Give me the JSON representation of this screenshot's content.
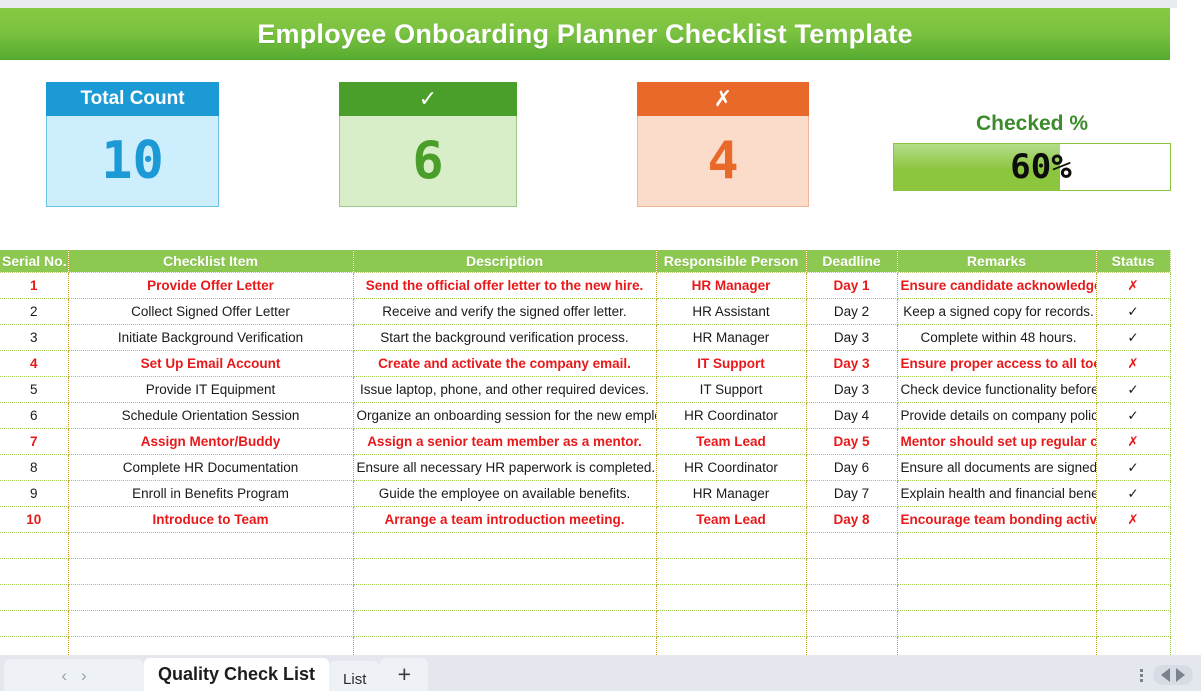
{
  "banner": {
    "title": "Employee Onboarding Planner Checklist Template"
  },
  "colors": {
    "brand_green": "#8cc63f",
    "header_green": "#8dc850",
    "blue": "#1b9ad6",
    "dark_green": "#4a9e2a",
    "orange": "#e8692a",
    "red": "#e8191a",
    "check_green": "#1e8c34"
  },
  "kpis": {
    "total": {
      "label": "Total Count",
      "value": "10"
    },
    "checked": {
      "label": "✓",
      "value": "6"
    },
    "unchecked": {
      "label": "✗",
      "value": "4"
    },
    "percent": {
      "label": "Checked %",
      "value": "60%",
      "fill_percent": 60
    }
  },
  "table": {
    "headers": [
      "Serial No.",
      "Checklist Item",
      "Description",
      "Responsible Person",
      "Deadline",
      "Remarks",
      "Status"
    ],
    "status_glyphs": {
      "done": "✓",
      "pending": "✗"
    },
    "rows": [
      {
        "serial": "1",
        "item": "Provide Offer Letter",
        "description": "Send the official offer letter to the new hire.",
        "responsible": "HR Manager",
        "deadline": "Day 1",
        "remarks": "Ensure candidate acknowledges receipt.",
        "status": "✗",
        "state": "pending"
      },
      {
        "serial": "2",
        "item": "Collect Signed Offer Letter",
        "description": "Receive and verify the signed offer letter.",
        "responsible": "HR Assistant",
        "deadline": "Day 2",
        "remarks": "Keep a signed copy for records.",
        "status": "✓",
        "state": "done"
      },
      {
        "serial": "3",
        "item": "Initiate Background Verification",
        "description": "Start the background verification process.",
        "responsible": "HR Manager",
        "deadline": "Day 3",
        "remarks": "Complete within 48 hours.",
        "status": "✓",
        "state": "done"
      },
      {
        "serial": "4",
        "item": "Set Up Email Account",
        "description": "Create and activate the company email.",
        "responsible": "IT Support",
        "deadline": "Day 3",
        "remarks": "Ensure proper access to all tools.",
        "status": "✗",
        "state": "pending"
      },
      {
        "serial": "5",
        "item": "Provide IT Equipment",
        "description": "Issue laptop, phone, and other required devices.",
        "responsible": "IT Support",
        "deadline": "Day 3",
        "remarks": "Check device functionality before handover.",
        "status": "✓",
        "state": "done"
      },
      {
        "serial": "6",
        "item": "Schedule Orientation Session",
        "description": "Organize an onboarding session for the new employee.",
        "responsible": "HR Coordinator",
        "deadline": "Day 4",
        "remarks": "Provide details on company policies.",
        "status": "✓",
        "state": "done"
      },
      {
        "serial": "7",
        "item": "Assign Mentor/Buddy",
        "description": "Assign a senior team member as a mentor.",
        "responsible": "Team Lead",
        "deadline": "Day 5",
        "remarks": "Mentor should set up regular check-ins.",
        "status": "✗",
        "state": "pending"
      },
      {
        "serial": "8",
        "item": "Complete HR Documentation",
        "description": "Ensure all necessary HR paperwork is completed.",
        "responsible": "HR Coordinator",
        "deadline": "Day 6",
        "remarks": "Ensure all documents are signed and filed.",
        "status": "✓",
        "state": "done"
      },
      {
        "serial": "9",
        "item": "Enroll in Benefits Program",
        "description": "Guide the employee on available benefits.",
        "responsible": "HR Manager",
        "deadline": "Day 7",
        "remarks": "Explain health and financial benefits.",
        "status": "✓",
        "state": "done"
      },
      {
        "serial": "10",
        "item": "Introduce to Team",
        "description": "Arrange a team introduction meeting.",
        "responsible": "Team Lead",
        "deadline": "Day 8",
        "remarks": "Encourage team bonding activities.",
        "status": "✗",
        "state": "pending"
      }
    ],
    "empty_row_count": 6
  },
  "tabbar": {
    "prev_label": "‹",
    "next_label": "›",
    "tabs": [
      {
        "label": "Quality Check List",
        "active": true
      },
      {
        "label": "List",
        "active": false
      }
    ],
    "add_label": "+"
  }
}
